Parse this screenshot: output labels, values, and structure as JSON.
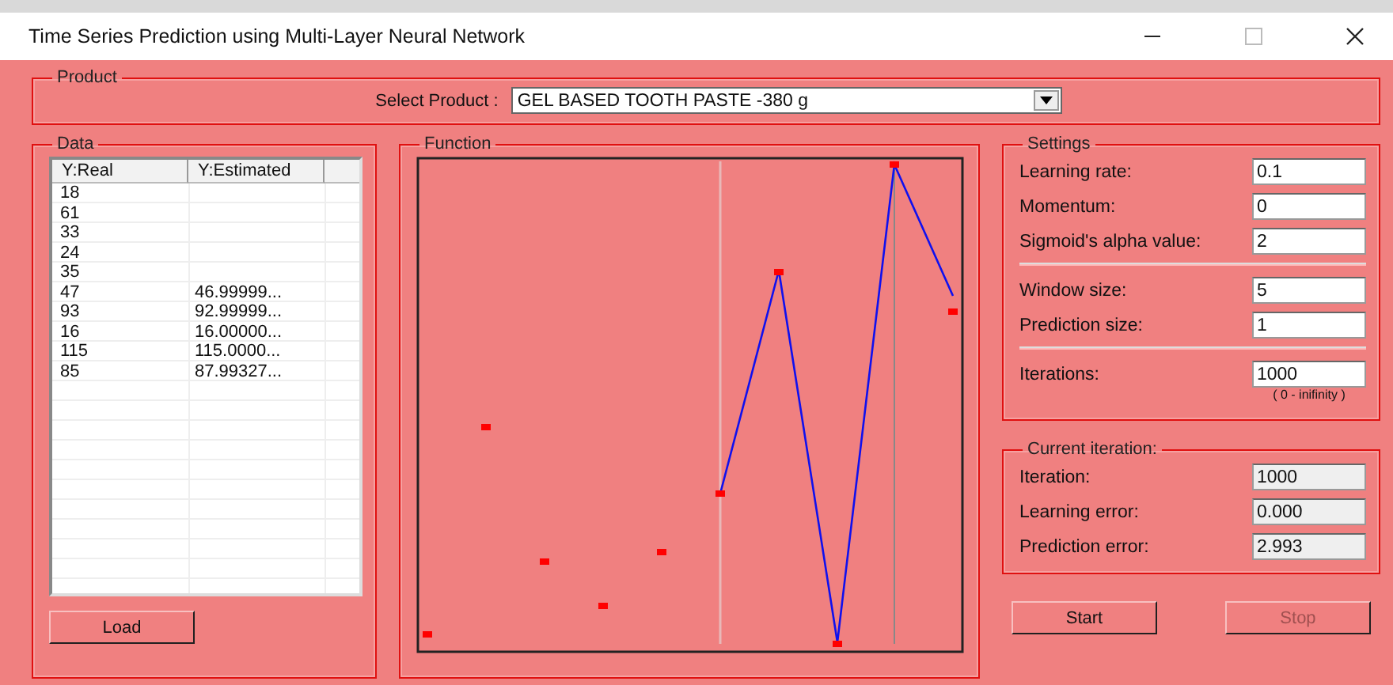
{
  "window": {
    "title": "Time Series Prediction using Multi-Layer Neural Network"
  },
  "product": {
    "title": "Product",
    "label": "Select Product :",
    "value": "GEL BASED TOOTH PASTE -380 g"
  },
  "data": {
    "title": "Data",
    "columns": [
      "Y:Real",
      "Y:Estimated"
    ],
    "rows": [
      [
        "18",
        ""
      ],
      [
        "61",
        ""
      ],
      [
        "33",
        ""
      ],
      [
        "24",
        ""
      ],
      [
        "35",
        ""
      ],
      [
        "47",
        "46.99999..."
      ],
      [
        "93",
        "92.99999..."
      ],
      [
        "16",
        "16.00000..."
      ],
      [
        "115",
        "115.0000..."
      ],
      [
        "85",
        "87.99327..."
      ]
    ],
    "load_button": "Load"
  },
  "function": {
    "title": "Function"
  },
  "settings": {
    "title": "Settings",
    "groups": [
      [
        {
          "label": "Learning rate:",
          "value": "0.1"
        },
        {
          "label": "Momentum:",
          "value": "0"
        },
        {
          "label": "Sigmoid's alpha value:",
          "value": "2"
        }
      ],
      [
        {
          "label": "Window size:",
          "value": "5"
        },
        {
          "label": "Prediction size:",
          "value": "1"
        }
      ],
      [
        {
          "label": "Iterations:",
          "value": "1000",
          "hint": "( 0 - inifinity )"
        }
      ]
    ]
  },
  "current": {
    "title": "Current iteration:",
    "fields": [
      {
        "label": "Iteration:",
        "value": "1000",
        "readonly": true
      },
      {
        "label": "Learning error:",
        "value": "0.000",
        "readonly": true
      },
      {
        "label": "Prediction error:",
        "value": "2.993",
        "readonly": true
      }
    ]
  },
  "buttons": [
    {
      "label": "Start",
      "disabled": false
    },
    {
      "label": "Stop",
      "disabled": true
    }
  ]
}
